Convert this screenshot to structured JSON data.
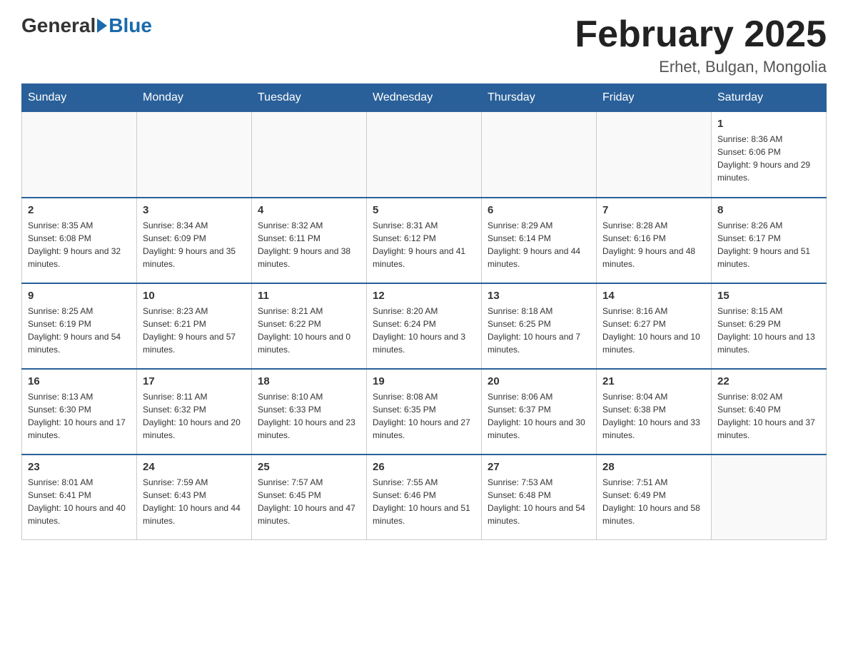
{
  "header": {
    "logo_text_general": "General",
    "logo_text_blue": "Blue",
    "month_title": "February 2025",
    "location": "Erhet, Bulgan, Mongolia"
  },
  "weekdays": [
    "Sunday",
    "Monday",
    "Tuesday",
    "Wednesday",
    "Thursday",
    "Friday",
    "Saturday"
  ],
  "weeks": [
    [
      {
        "day": "",
        "info": ""
      },
      {
        "day": "",
        "info": ""
      },
      {
        "day": "",
        "info": ""
      },
      {
        "day": "",
        "info": ""
      },
      {
        "day": "",
        "info": ""
      },
      {
        "day": "",
        "info": ""
      },
      {
        "day": "1",
        "info": "Sunrise: 8:36 AM\nSunset: 6:06 PM\nDaylight: 9 hours and 29 minutes."
      }
    ],
    [
      {
        "day": "2",
        "info": "Sunrise: 8:35 AM\nSunset: 6:08 PM\nDaylight: 9 hours and 32 minutes."
      },
      {
        "day": "3",
        "info": "Sunrise: 8:34 AM\nSunset: 6:09 PM\nDaylight: 9 hours and 35 minutes."
      },
      {
        "day": "4",
        "info": "Sunrise: 8:32 AM\nSunset: 6:11 PM\nDaylight: 9 hours and 38 minutes."
      },
      {
        "day": "5",
        "info": "Sunrise: 8:31 AM\nSunset: 6:12 PM\nDaylight: 9 hours and 41 minutes."
      },
      {
        "day": "6",
        "info": "Sunrise: 8:29 AM\nSunset: 6:14 PM\nDaylight: 9 hours and 44 minutes."
      },
      {
        "day": "7",
        "info": "Sunrise: 8:28 AM\nSunset: 6:16 PM\nDaylight: 9 hours and 48 minutes."
      },
      {
        "day": "8",
        "info": "Sunrise: 8:26 AM\nSunset: 6:17 PM\nDaylight: 9 hours and 51 minutes."
      }
    ],
    [
      {
        "day": "9",
        "info": "Sunrise: 8:25 AM\nSunset: 6:19 PM\nDaylight: 9 hours and 54 minutes."
      },
      {
        "day": "10",
        "info": "Sunrise: 8:23 AM\nSunset: 6:21 PM\nDaylight: 9 hours and 57 minutes."
      },
      {
        "day": "11",
        "info": "Sunrise: 8:21 AM\nSunset: 6:22 PM\nDaylight: 10 hours and 0 minutes."
      },
      {
        "day": "12",
        "info": "Sunrise: 8:20 AM\nSunset: 6:24 PM\nDaylight: 10 hours and 3 minutes."
      },
      {
        "day": "13",
        "info": "Sunrise: 8:18 AM\nSunset: 6:25 PM\nDaylight: 10 hours and 7 minutes."
      },
      {
        "day": "14",
        "info": "Sunrise: 8:16 AM\nSunset: 6:27 PM\nDaylight: 10 hours and 10 minutes."
      },
      {
        "day": "15",
        "info": "Sunrise: 8:15 AM\nSunset: 6:29 PM\nDaylight: 10 hours and 13 minutes."
      }
    ],
    [
      {
        "day": "16",
        "info": "Sunrise: 8:13 AM\nSunset: 6:30 PM\nDaylight: 10 hours and 17 minutes."
      },
      {
        "day": "17",
        "info": "Sunrise: 8:11 AM\nSunset: 6:32 PM\nDaylight: 10 hours and 20 minutes."
      },
      {
        "day": "18",
        "info": "Sunrise: 8:10 AM\nSunset: 6:33 PM\nDaylight: 10 hours and 23 minutes."
      },
      {
        "day": "19",
        "info": "Sunrise: 8:08 AM\nSunset: 6:35 PM\nDaylight: 10 hours and 27 minutes."
      },
      {
        "day": "20",
        "info": "Sunrise: 8:06 AM\nSunset: 6:37 PM\nDaylight: 10 hours and 30 minutes."
      },
      {
        "day": "21",
        "info": "Sunrise: 8:04 AM\nSunset: 6:38 PM\nDaylight: 10 hours and 33 minutes."
      },
      {
        "day": "22",
        "info": "Sunrise: 8:02 AM\nSunset: 6:40 PM\nDaylight: 10 hours and 37 minutes."
      }
    ],
    [
      {
        "day": "23",
        "info": "Sunrise: 8:01 AM\nSunset: 6:41 PM\nDaylight: 10 hours and 40 minutes."
      },
      {
        "day": "24",
        "info": "Sunrise: 7:59 AM\nSunset: 6:43 PM\nDaylight: 10 hours and 44 minutes."
      },
      {
        "day": "25",
        "info": "Sunrise: 7:57 AM\nSunset: 6:45 PM\nDaylight: 10 hours and 47 minutes."
      },
      {
        "day": "26",
        "info": "Sunrise: 7:55 AM\nSunset: 6:46 PM\nDaylight: 10 hours and 51 minutes."
      },
      {
        "day": "27",
        "info": "Sunrise: 7:53 AM\nSunset: 6:48 PM\nDaylight: 10 hours and 54 minutes."
      },
      {
        "day": "28",
        "info": "Sunrise: 7:51 AM\nSunset: 6:49 PM\nDaylight: 10 hours and 58 minutes."
      },
      {
        "day": "",
        "info": ""
      }
    ]
  ]
}
